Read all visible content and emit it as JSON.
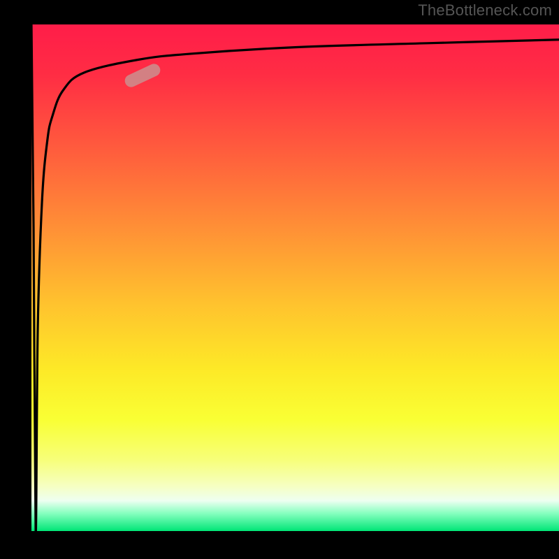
{
  "attribution": "TheBottleneck.com",
  "chart_data": {
    "type": "line",
    "title": "",
    "xlabel": "",
    "ylabel": "",
    "xlim": [
      0,
      100
    ],
    "ylim": [
      0,
      100
    ],
    "grid": false,
    "series": [
      {
        "name": "curve",
        "x": [
          0,
          0.4,
          0.8,
          1.2,
          2,
          3,
          4,
          6,
          10,
          20,
          30,
          50,
          75,
          100
        ],
        "values": [
          100,
          60,
          0,
          40,
          65,
          77,
          82,
          87,
          90.5,
          93,
          94.2,
          95.5,
          96.3,
          97
        ]
      }
    ],
    "marker": {
      "x_pct": 21,
      "y_pct": 10,
      "rotation_deg": -25,
      "color": "rgba(205,140,140,0.88)"
    },
    "gradient_stops": [
      {
        "offset": 0,
        "color": "#ff1d49"
      },
      {
        "offset": 0.1,
        "color": "#ff2d44"
      },
      {
        "offset": 0.25,
        "color": "#ff5d3d"
      },
      {
        "offset": 0.4,
        "color": "#ff8f36"
      },
      {
        "offset": 0.55,
        "color": "#ffc22e"
      },
      {
        "offset": 0.68,
        "color": "#fde927"
      },
      {
        "offset": 0.78,
        "color": "#f9ff34"
      },
      {
        "offset": 0.86,
        "color": "#f7ff7a"
      },
      {
        "offset": 0.91,
        "color": "#f6ffc0"
      },
      {
        "offset": 0.94,
        "color": "#eefff1"
      },
      {
        "offset": 0.965,
        "color": "#86ffbf"
      },
      {
        "offset": 1.0,
        "color": "#00e676"
      }
    ],
    "curve_stroke": "#000",
    "curve_stroke_width": 3.2
  }
}
